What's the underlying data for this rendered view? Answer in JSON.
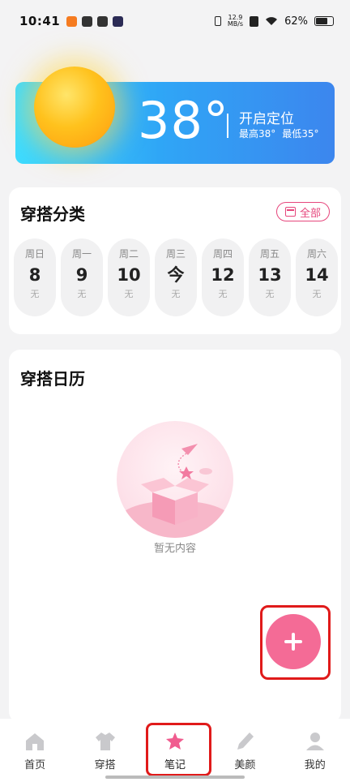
{
  "status_bar": {
    "time": "10:41",
    "net_speed_value": "12.9",
    "net_speed_unit": "MB/s",
    "battery": "62%"
  },
  "weather": {
    "temperature": "38°",
    "locate_label": "开启定位",
    "high": "最高38°",
    "low": "最低35°"
  },
  "category": {
    "title": "穿搭分类",
    "all_label": "全部",
    "days": [
      {
        "week": "周日",
        "num": "8",
        "status": "无"
      },
      {
        "week": "周一",
        "num": "9",
        "status": "无"
      },
      {
        "week": "周二",
        "num": "10",
        "status": "无"
      },
      {
        "week": "周三",
        "num": "今",
        "status": "无"
      },
      {
        "week": "周四",
        "num": "12",
        "status": "无"
      },
      {
        "week": "周五",
        "num": "13",
        "status": "无"
      },
      {
        "week": "周六",
        "num": "14",
        "status": "无"
      }
    ]
  },
  "diary": {
    "title": "穿搭日历",
    "empty_text": "暂无内容"
  },
  "fab_label": "+",
  "nav": {
    "items": [
      {
        "label": "首页",
        "icon": "home-icon"
      },
      {
        "label": "穿搭",
        "icon": "clothes-icon"
      },
      {
        "label": "笔记",
        "icon": "star-icon"
      },
      {
        "label": "美颜",
        "icon": "pen-icon"
      },
      {
        "label": "我的",
        "icon": "user-icon"
      }
    ]
  },
  "colors": {
    "accent": "#f46b96",
    "highlight": "#e01a1a",
    "weather_gradient_start": "#3ddcff",
    "weather_gradient_end": "#3c86ee"
  }
}
